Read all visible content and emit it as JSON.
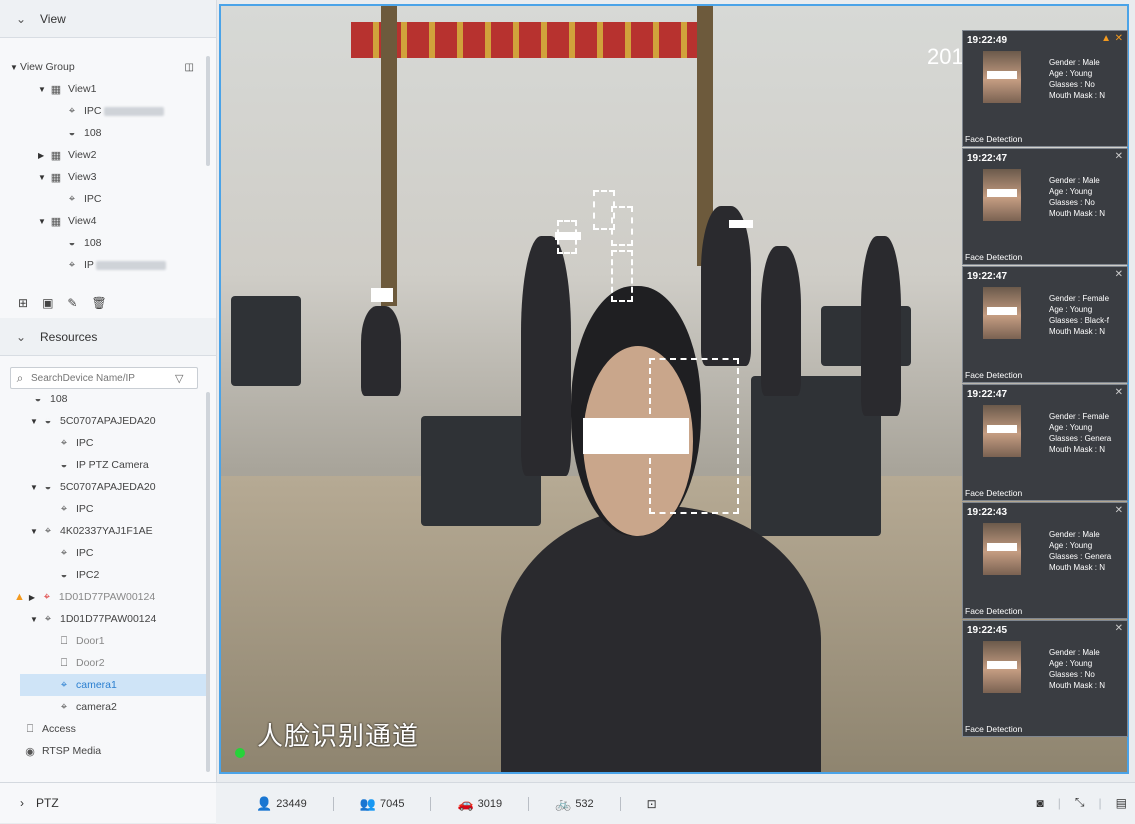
{
  "left": {
    "view_section": {
      "title": "View"
    },
    "view_tree": [
      {
        "label": "View Group",
        "type": "group"
      },
      {
        "label": "View1",
        "type": "view"
      },
      {
        "label": "IPC",
        "type": "camera",
        "blurred": true
      },
      {
        "label": "108",
        "type": "dome"
      },
      {
        "label": "View2",
        "type": "view"
      },
      {
        "label": "View3",
        "type": "view"
      },
      {
        "label": "IPC",
        "type": "camera"
      },
      {
        "label": "View4",
        "type": "view"
      },
      {
        "label": "108",
        "type": "dome"
      },
      {
        "label": "IP",
        "type": "camera",
        "blurred": true
      }
    ],
    "resources_section": {
      "title": "Resources"
    },
    "search": {
      "placeholder": "SearchDevice Name/IP"
    },
    "resource_tree": [
      {
        "label": "108"
      },
      {
        "label": "5C0707APAJEDA20"
      },
      {
        "label": "IPC"
      },
      {
        "label": "IP PTZ Camera"
      },
      {
        "label": "5C0707APAJEDA20"
      },
      {
        "label": "IPC"
      },
      {
        "label": "4K02337YAJ1F1AE"
      },
      {
        "label": "IPC"
      },
      {
        "label": "IPC2"
      },
      {
        "label": "1D01D77PAW00124"
      },
      {
        "label": "1D01D77PAW00124"
      },
      {
        "label": "Door1"
      },
      {
        "label": "Door2"
      },
      {
        "label": "camera1"
      },
      {
        "label": "camera2"
      },
      {
        "label": "Access"
      },
      {
        "label": "RTSP Media"
      }
    ],
    "ptz": {
      "title": "PTZ"
    }
  },
  "video": {
    "overlay_text": "人脸识别通道",
    "timestamp": "201"
  },
  "faces": [
    {
      "time": "19:22:49",
      "gender": "Gender : Male",
      "age": "Age : Young",
      "glasses": "Glasses : No",
      "mask": "Mouth Mask : N",
      "label": "Face Detection"
    },
    {
      "time": "19:22:47",
      "gender": "Gender : Male",
      "age": "Age : Young",
      "glasses": "Glasses : No",
      "mask": "Mouth Mask : N",
      "label": "Face Detection"
    },
    {
      "time": "19:22:47",
      "gender": "Gender : Female",
      "age": "Age : Young",
      "glasses": "Glasses : Black-f",
      "mask": "Mouth Mask : N",
      "label": "Face Detection"
    },
    {
      "time": "19:22:47",
      "gender": "Gender : Female",
      "age": "Age : Young",
      "glasses": "Glasses : Genera",
      "mask": "Mouth Mask : N",
      "label": "Face Detection"
    },
    {
      "time": "19:22:43",
      "gender": "Gender : Male",
      "age": "Age : Young",
      "glasses": "Glasses : Genera",
      "mask": "Mouth Mask : N",
      "label": "Face Detection"
    },
    {
      "time": "19:22:45",
      "gender": "Gender : Male",
      "age": "Age : Young",
      "glasses": "Glasses : No",
      "mask": "Mouth Mask : N",
      "label": "Face Detection"
    }
  ],
  "stats": {
    "people": "23449",
    "crowd": "7045",
    "vehicles": "3019",
    "bikes": "532"
  },
  "colors": {
    "accent": "#4aa3e8",
    "selected": "#2b7fd0",
    "warning": "#f39a1f"
  }
}
